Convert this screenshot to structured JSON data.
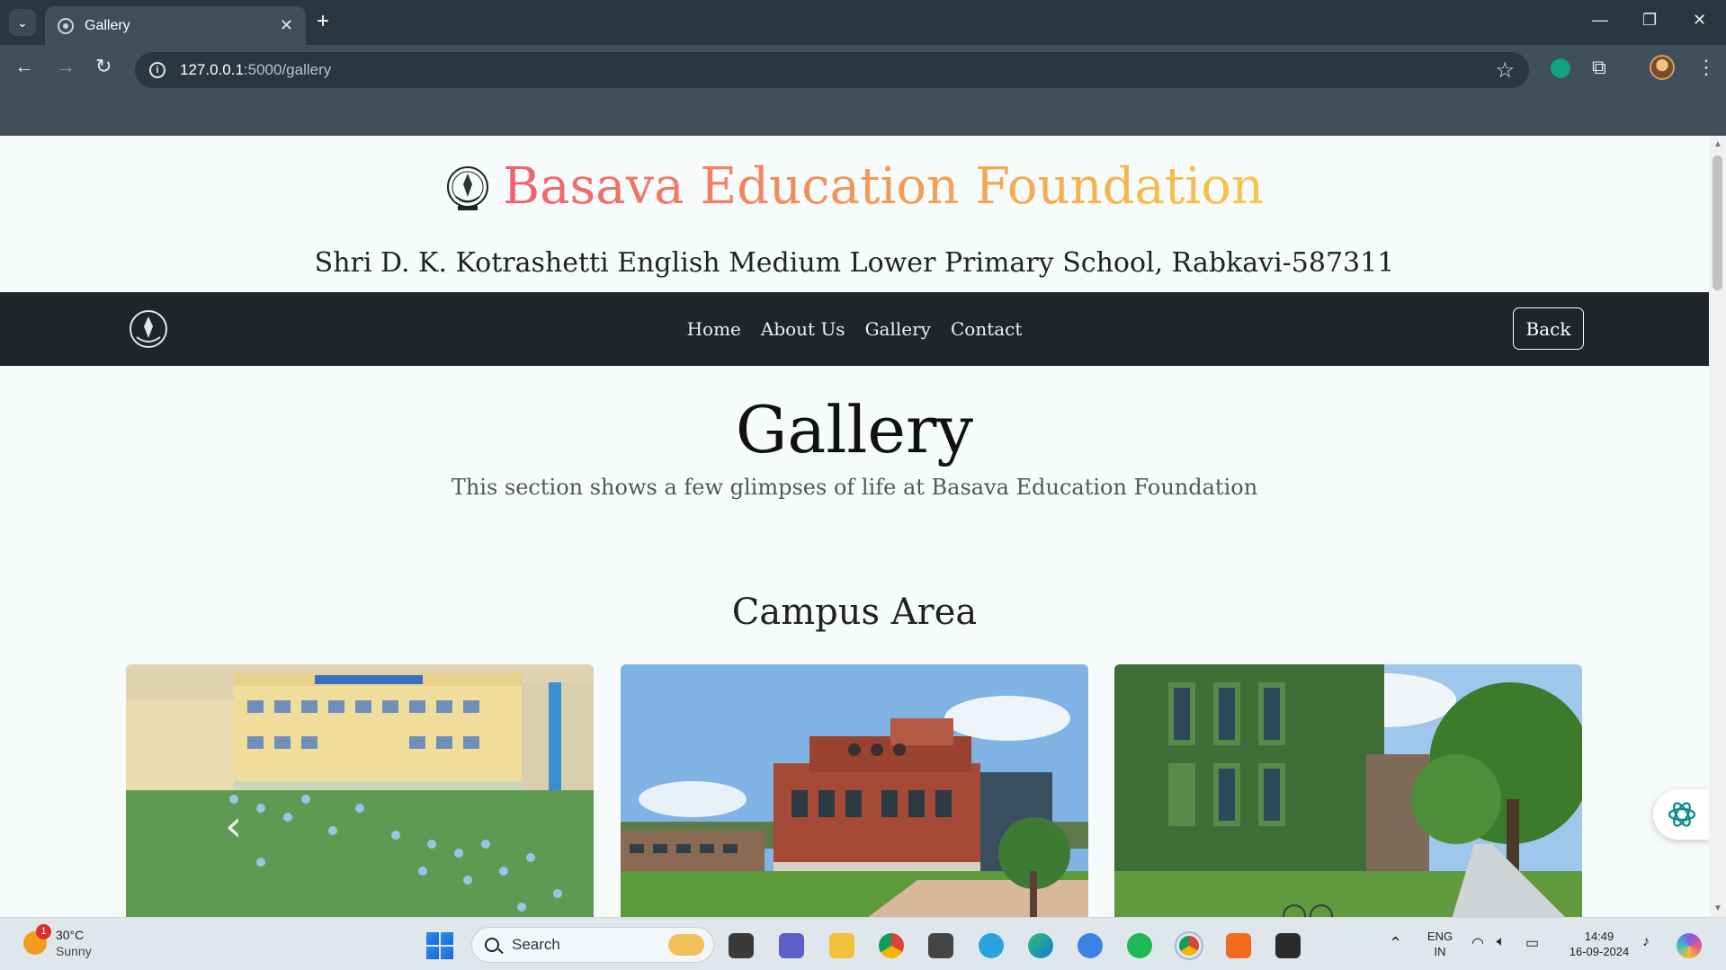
{
  "browser": {
    "tab_title": "Gallery",
    "url_host": "127.0.0.1",
    "url_path": ":5000/gallery"
  },
  "site": {
    "brand_title": "Basava Education Foundation",
    "school_line": "Shri D. K. Kotrashetti English Medium Lower Primary School, Rabkavi-587311",
    "nav": {
      "links": [
        "Home",
        "About Us",
        "Gallery",
        "Contact"
      ],
      "back_label": "Back"
    },
    "gallery": {
      "title": "Gallery",
      "subtitle": "This section shows a few glimpses of life at Basava Education Foundation",
      "section_title": "Campus Area"
    },
    "carousel_prev_glyph": "‹"
  },
  "taskbar": {
    "weather_temp": "30°C",
    "weather_cond": "Sunny",
    "weather_badge": "1",
    "search_placeholder": "Search",
    "lang_line1": "ENG",
    "lang_line2": "IN",
    "time": "14:49",
    "date": "16-09-2024"
  },
  "colors": {
    "brand_gradient": [
      "#f0606e",
      "#f39a55",
      "#f8c64c"
    ],
    "navbar": "#20252a",
    "browser_chrome": "#3f4f5b"
  }
}
